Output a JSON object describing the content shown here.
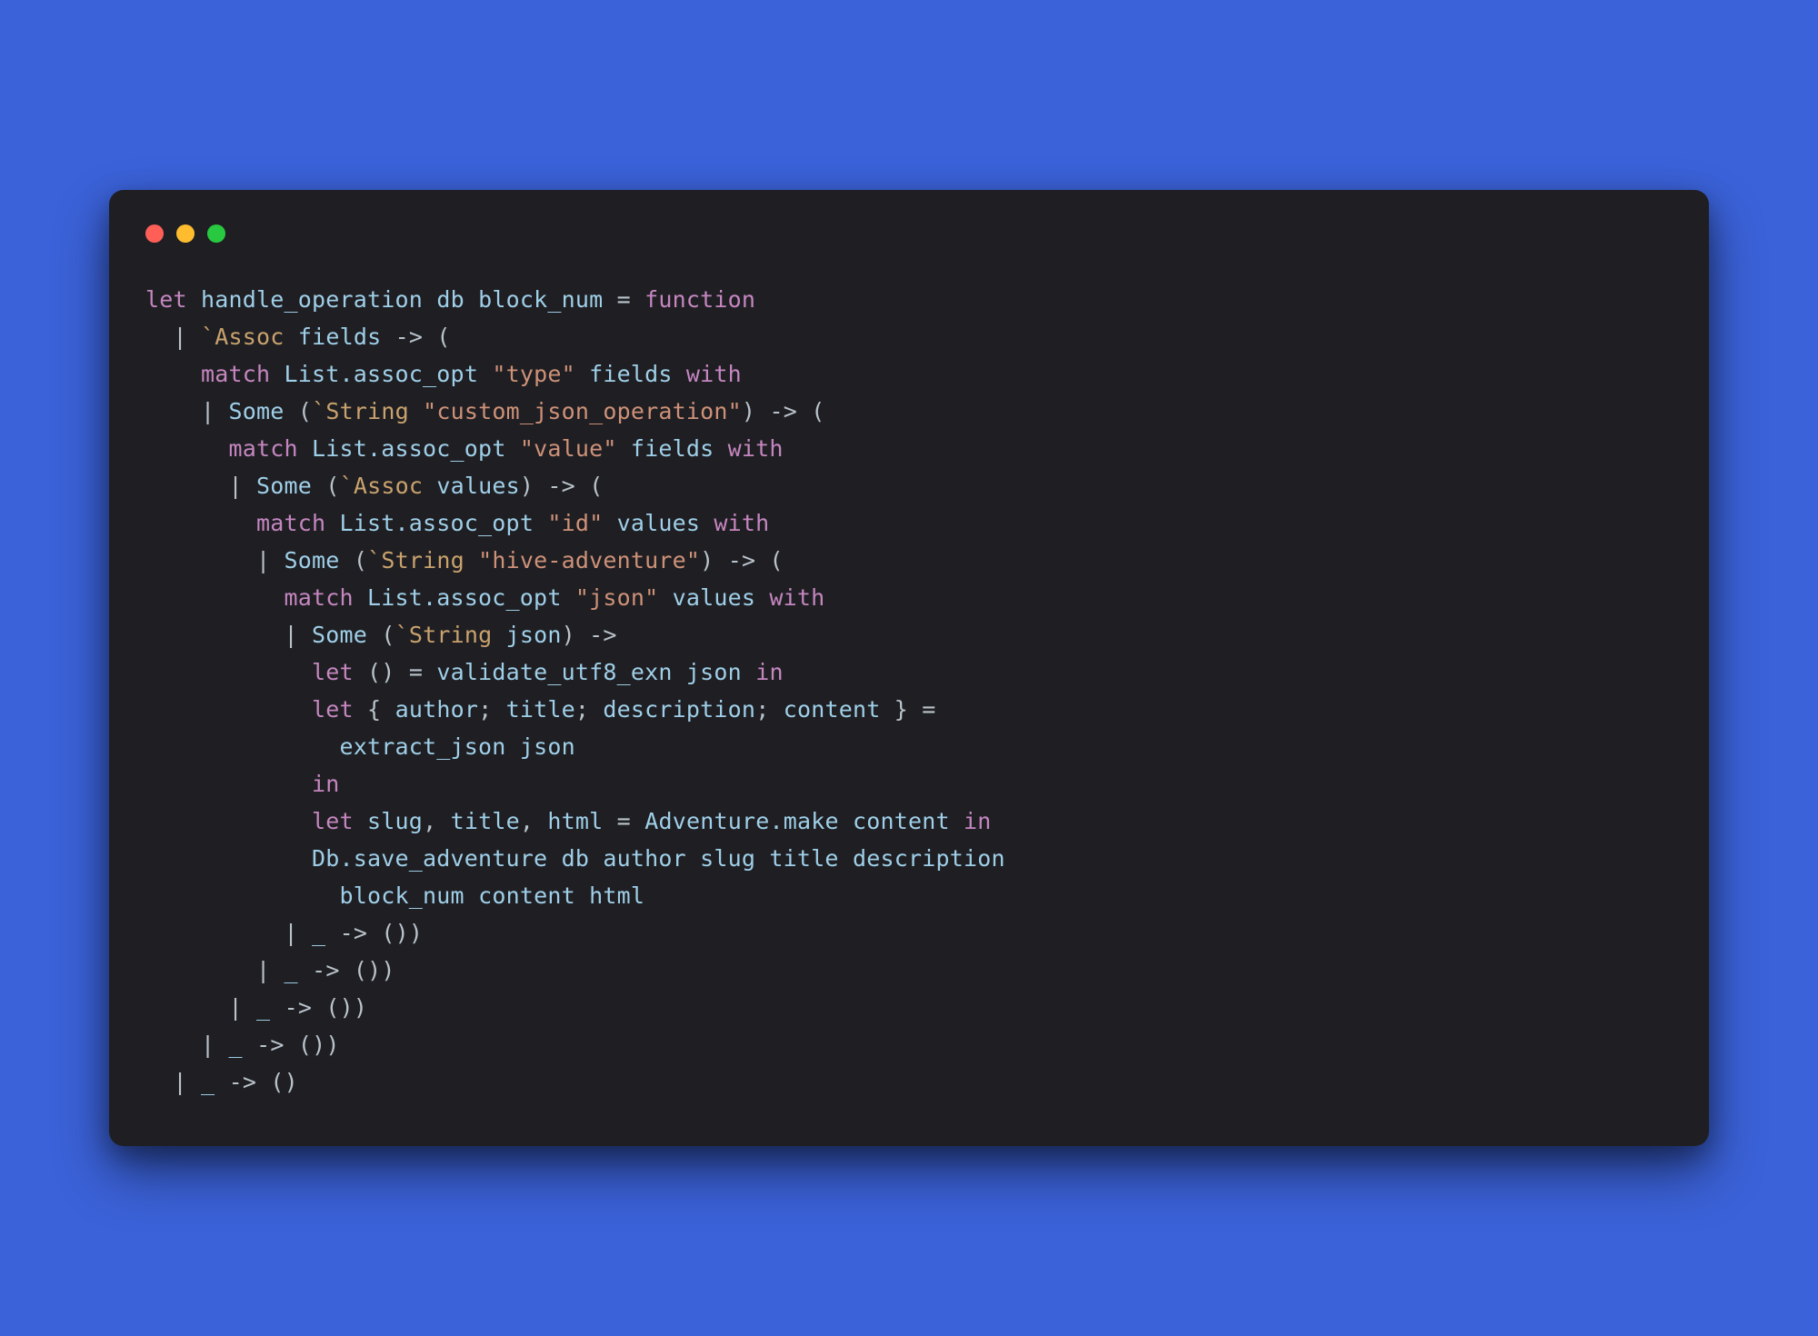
{
  "window": {
    "controls": {
      "close": "red",
      "minimize": "yellow",
      "zoom": "green"
    }
  },
  "code": {
    "l1": {
      "let": "let",
      "name": "handle_operation",
      "arg1": "db",
      "arg2": "block_num",
      "eq": "=",
      "fn": "function"
    },
    "l2": {
      "pipe": "|",
      "tag": "`Assoc",
      "arg": "fields",
      "arr": "->",
      "op": "("
    },
    "l3": {
      "match": "match",
      "call": "List.assoc_opt",
      "str": "\"type\"",
      "arg": "fields",
      "with": "with"
    },
    "l4": {
      "pipe": "|",
      "some": "Some",
      "op": "(",
      "tag": "`String",
      "str": "\"custom_json_operation\"",
      "cl": ")",
      "arr": "->",
      "op2": "("
    },
    "l5": {
      "match": "match",
      "call": "List.assoc_opt",
      "str": "\"value\"",
      "arg": "fields",
      "with": "with"
    },
    "l6": {
      "pipe": "|",
      "some": "Some",
      "op": "(",
      "tag": "`Assoc",
      "arg": "values",
      "cl": ")",
      "arr": "->",
      "op2": "("
    },
    "l7": {
      "match": "match",
      "call": "List.assoc_opt",
      "str": "\"id\"",
      "arg": "values",
      "with": "with"
    },
    "l8": {
      "pipe": "|",
      "some": "Some",
      "op": "(",
      "tag": "`String",
      "str": "\"hive-adventure\"",
      "cl": ")",
      "arr": "->",
      "op2": "("
    },
    "l9": {
      "match": "match",
      "call": "List.assoc_opt",
      "str": "\"json\"",
      "arg": "values",
      "with": "with"
    },
    "l10": {
      "pipe": "|",
      "some": "Some",
      "op": "(",
      "tag": "`String",
      "arg": "json",
      "cl": ")",
      "arr": "->"
    },
    "l11": {
      "let": "let",
      "unit": "()",
      "eq": "=",
      "fn": "validate_utf8_exn",
      "arg": "json",
      "in": "in"
    },
    "l12": {
      "let": "let",
      "ob": "{",
      "a": "author",
      "s1": ";",
      "b": "title",
      "s2": ";",
      "c": "description",
      "s3": ";",
      "d": "content",
      "cb": "}",
      "eq": "="
    },
    "l13": {
      "fn": "extract_json",
      "arg": "json"
    },
    "l14": {
      "in": "in"
    },
    "l15": {
      "let": "let",
      "a": "slug",
      "c1": ",",
      "b": "title",
      "c2": ",",
      "c": "html",
      "eq": "=",
      "mod": "Adventure.make",
      "arg": "content",
      "in": "in"
    },
    "l16": {
      "mod": "Db.save_adventure",
      "a": "db",
      "b": "author",
      "c": "slug",
      "d": "title",
      "e": "description"
    },
    "l17": {
      "a": "block_num",
      "b": "content",
      "c": "html"
    },
    "l18": {
      "pipe": "|",
      "us": "_",
      "arr": "->",
      "unit": "())"
    },
    "l19": {
      "pipe": "|",
      "us": "_",
      "arr": "->",
      "unit": "())"
    },
    "l20": {
      "pipe": "|",
      "us": "_",
      "arr": "->",
      "unit": "())"
    },
    "l21": {
      "pipe": "|",
      "us": "_",
      "arr": "->",
      "unit": "())"
    },
    "l22": {
      "pipe": "|",
      "us": "_",
      "arr": "->",
      "unit": "()"
    }
  }
}
